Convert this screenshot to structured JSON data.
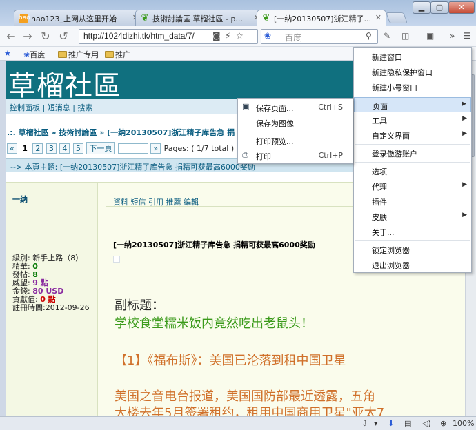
{
  "tabs": [
    {
      "title": "hao123_上网从这里开始",
      "icon": "hao",
      "icon_text": "hao"
    },
    {
      "title": "技術討論區 草榴社區 - p...",
      "icon": "leaf-icon"
    },
    {
      "title": "[一纳20130507]浙江精子...",
      "icon": "leaf-icon",
      "active": true
    }
  ],
  "toolbar": {
    "url": "http://1024dizhi.tk/htm_data/7/",
    "search_placeholder": "百度"
  },
  "bookmarks": [
    {
      "label": "百度",
      "icon": "paw-icon"
    },
    {
      "label": "推广专用",
      "icon": "folder-icon"
    },
    {
      "label": "推广",
      "icon": "folder-icon"
    }
  ],
  "page": {
    "site_title": "草榴社區",
    "subnav": "控制面板 | 短消息 | 搜索",
    "breadcrumb": ".:. 草榴社區 » 技術討論區 » [一纳20130507]浙江精子库告急 捐",
    "pager": {
      "prev": "«",
      "pages": [
        "1",
        "2",
        "3",
        "4",
        "5"
      ],
      "next": "下一頁",
      "go": "»",
      "info": "Pages: ( 1/7 total )"
    },
    "topic_bar": "--> 本頁主題: [一纳20130507]浙江精子库告急 捐精可获最高6000奖励",
    "post": {
      "author": "一纳",
      "user_info": {
        "level": "級別: 新手上路（8）",
        "jinghua_label": "精華: ",
        "jinghua": "0",
        "posts_label": "發帖: ",
        "posts": "8",
        "weiwang_label": "威望: ",
        "weiwang": "9 點",
        "jinqian_label": "金錢: ",
        "jinqian": "80 USD",
        "gongxian_label": "貢獻值: ",
        "gongxian": "0 點",
        "reg": "註冊時間:2012-09-26"
      },
      "actions": "資料 短信 引用 推薦 編輯",
      "title": "[一纳20130507]浙江精子库告急 捐精可获最高6000奖励",
      "subtitle": "副标题：",
      "line_green": "学校食堂糯米饭内竟然吃出老鼠头！",
      "line_orange1": "【1】《福布斯》：美国已沦落到租中国卫星",
      "line_orange2": "美国之音电台报道，美国国防部最近透露，五角",
      "line_orange3": "大楼去年5月签署租约，租用中国商用卫星\"亚太7"
    }
  },
  "main_menu": {
    "items": [
      {
        "label": "新建窗口"
      },
      {
        "label": "新建隐私保护窗口"
      },
      {
        "label": "新建小号窗口"
      },
      {
        "label": "页面",
        "submenu": true,
        "highlighted": true
      },
      {
        "label": "工具",
        "submenu": true
      },
      {
        "label": "自定义界面",
        "submenu": true
      },
      {
        "label": "登录傲游账户"
      },
      {
        "label": "选项"
      },
      {
        "label": "代理",
        "submenu": true
      },
      {
        "label": "插件"
      },
      {
        "label": "皮肤",
        "submenu": true
      },
      {
        "label": "关于..."
      },
      {
        "label": "锁定浏览器"
      },
      {
        "label": "退出浏览器"
      }
    ]
  },
  "sub_menu": {
    "items": [
      {
        "label": "保存页面...",
        "shortcut": "Ctrl+S",
        "icon": "save-icon"
      },
      {
        "label": "保存为图像",
        "shortcut": ""
      },
      {
        "label": "打印预览...",
        "shortcut": ""
      },
      {
        "label": "打印",
        "shortcut": "Ctrl+P",
        "icon": "printer-icon"
      }
    ]
  },
  "status": {
    "zoom": "100%"
  }
}
